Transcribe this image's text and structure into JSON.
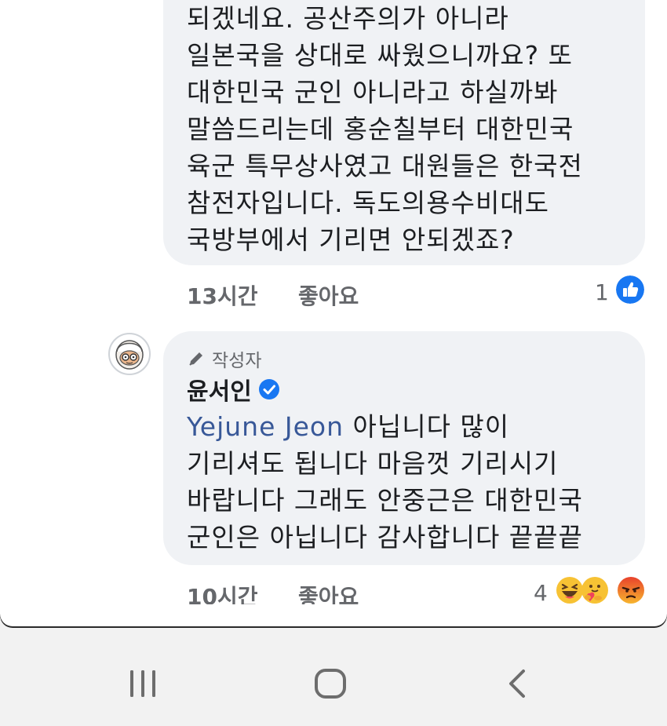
{
  "comment1": {
    "text": "되겠네요. 공산주의가 아니라\n일본국을 상대로 싸웠으니까요? 또\n대한민국 군인 아니라고 하실까봐\n말씀드리는데 홍순칠부터 대한민국\n육군 특무상사였고 대원들은 한국전\n참전자입니다. 독도의용수비대도\n국방부에서 기리면 안되겠죠?",
    "time": "13시간",
    "like_label": "좋아요",
    "reaction_count": "1",
    "reactions": [
      "like-icon"
    ]
  },
  "comment2": {
    "author_badge": "작성자",
    "author_name": "윤서인",
    "mention": "Yejune Jeon",
    "text": " 아닙니다 많이\n기리셔도 됩니다 마음껏 기리시기\n바랍니다 그래도 안중근은 대한민국\n군인은 아닙니다 감사합니다 끝끝끝",
    "time": "10시간",
    "like_label": "좋아요",
    "reaction_count": "4",
    "reactions": [
      "haha-icon",
      "care-icon",
      "angry-icon"
    ]
  },
  "navbar": {
    "buttons": [
      "recent-apps-icon",
      "home-icon",
      "back-icon"
    ]
  },
  "colors": {
    "bubble": "#f0f2f5",
    "meta": "#65676b",
    "mention": "#385898",
    "like_blue": "#1877f2",
    "navbar": "#f2f2f2"
  }
}
